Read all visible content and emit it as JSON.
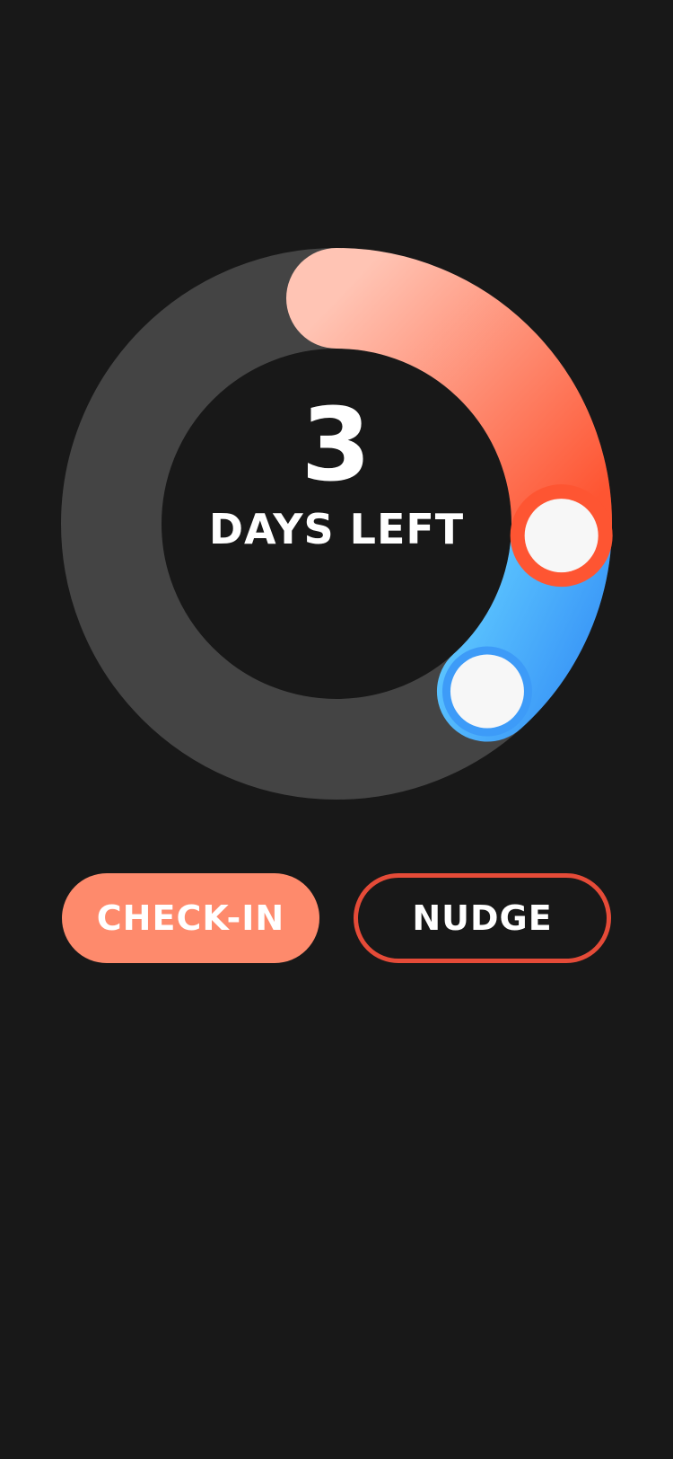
{
  "countdown": {
    "number": "3",
    "label": "DAYS LEFT"
  },
  "progress_ring": {
    "track_color": "#444444",
    "segments": [
      {
        "name": "orange-arc",
        "gradient": [
          "#ffc4b4",
          "#fe5532"
        ],
        "start_deg": 0,
        "end_deg": 93,
        "handle_ring_color": "#fe5532"
      },
      {
        "name": "blue-arc",
        "gradient": [
          "#5ec8ff",
          "#3d9bf8"
        ],
        "start_deg": 93,
        "end_deg": 138,
        "handle_ring_color": "#3d9bf8"
      }
    ],
    "handle_fill": "#f7f7f7"
  },
  "actions": {
    "checkin_label": "CHECK-IN",
    "nudge_label": "NUDGE"
  },
  "colors": {
    "background": "#181818",
    "checkin_fill": "#fe8a6c",
    "nudge_border": "#e54b38",
    "text": "#ffffff"
  },
  "icons": {
    "handle": "circle-handle-icon"
  }
}
